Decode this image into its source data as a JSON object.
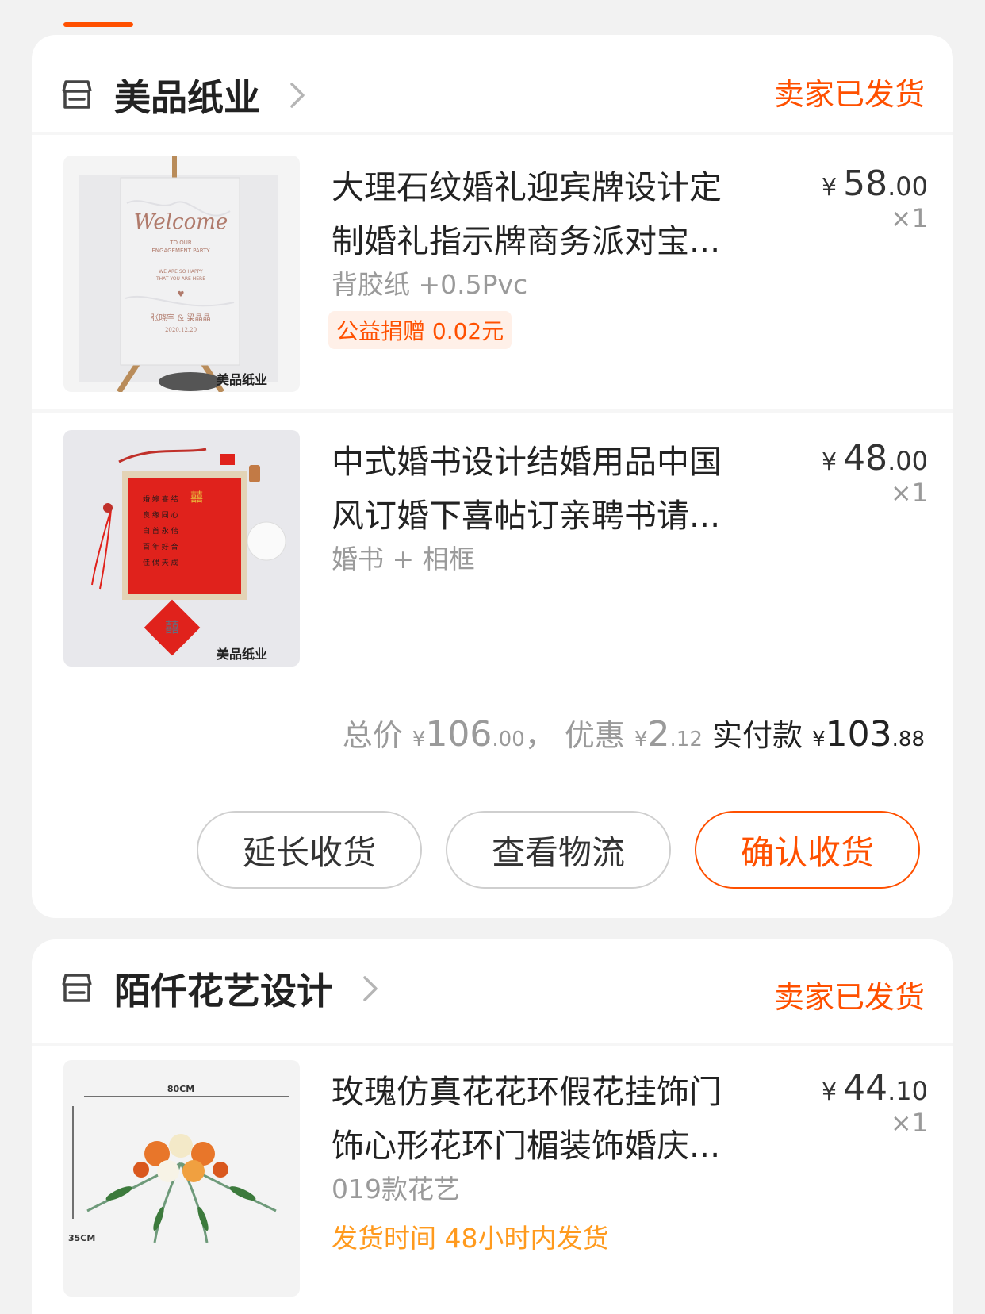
{
  "orders": [
    {
      "shop": "美品纸业",
      "status": "卖家已发货",
      "items": [
        {
          "title_line1": "大理石纹婚礼迎宾牌设计定",
          "title_line2": "制婚礼指示牌商务派对宝...",
          "sku": "背胶纸 +0.5Pvc",
          "badge": "公益捐赠 0.02元",
          "price_yen": "¥",
          "price_int": "58",
          "price_dec": ".00",
          "qty": "×1",
          "thumb_text": [
            "Welcome",
            "TO OUR",
            "ENGAGEMENT PARTY",
            "WE ARE SO HAPPY",
            "THAT YOU ARE HERE",
            "张晓宇 & 梁晶晶",
            "2020.12.20",
            "美品纸业"
          ]
        },
        {
          "title_line1": "中式婚书设计结婚用品中国",
          "title_line2": "风订婚下喜帖订亲聘书请...",
          "sku": "婚书 + 相框",
          "price_yen": "¥",
          "price_int": "48",
          "price_dec": ".00",
          "qty": "×1",
          "thumb_text": [
            "美品纸业"
          ]
        }
      ],
      "summary": {
        "total_label": "总价",
        "total_yen": "¥",
        "total_int": "106",
        "total_dec": ".00",
        "sep": "，",
        "discount_label": "优惠",
        "discount_yen": "¥",
        "discount_int": "2",
        "discount_dec": ".12",
        "paid_label": "实付款",
        "paid_yen": "¥",
        "paid_int": "103",
        "paid_dec": ".88"
      },
      "buttons": {
        "extend": "延长收货",
        "logistics": "查看物流",
        "confirm": "确认收货"
      }
    },
    {
      "shop": "陌仟花艺设计",
      "status": "卖家已发货",
      "items": [
        {
          "title_line1": "玫瑰仿真花花环假花挂饰门",
          "title_line2": "饰心形花环门楣装饰婚庆...",
          "sku": "019款花艺",
          "ship": "发货时间  48小时内发货",
          "price_yen": "¥",
          "price_int": "44",
          "price_dec": ".10",
          "qty": "×1",
          "thumb_text": [
            "80CM",
            "35CM"
          ]
        }
      ]
    }
  ],
  "colors": {
    "accent": "#ff5000",
    "ship": "#ff9a1e"
  },
  "icons": [
    "shop-icon",
    "chevron-right-icon"
  ]
}
